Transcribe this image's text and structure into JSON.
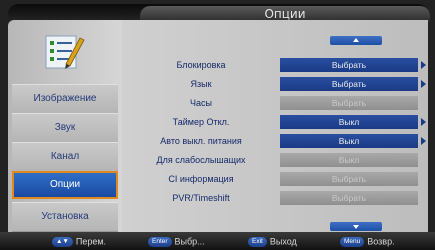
{
  "title": "Опции",
  "logo_icon": "checklist-pencil-icon",
  "menu": [
    {
      "label": "Изображение",
      "active": false
    },
    {
      "label": "Звук",
      "active": false
    },
    {
      "label": "Канал",
      "active": false
    },
    {
      "label": "Опции",
      "active": true
    },
    {
      "label": "Установка",
      "active": false
    }
  ],
  "options": [
    {
      "label": "Блокировка",
      "value": "Выбрать",
      "enabled": true,
      "arrow": true
    },
    {
      "label": "Язык",
      "value": "Выбрать",
      "enabled": true,
      "arrow": true
    },
    {
      "label": "Часы",
      "value": "Выбрать",
      "enabled": false,
      "arrow": false
    },
    {
      "label": "Таймер Откл.",
      "value": "Выкл",
      "enabled": true,
      "arrow": true
    },
    {
      "label": "Авто выкл. питания",
      "value": "Выкл",
      "enabled": true,
      "arrow": true
    },
    {
      "label": "Для слабослышащих",
      "value": "Выкл",
      "enabled": false,
      "arrow": false
    },
    {
      "label": "CI информация",
      "value": "Выбрать",
      "enabled": false,
      "arrow": false
    },
    {
      "label": "PVR/Timeshift",
      "value": "Выбрать",
      "enabled": false,
      "arrow": false
    }
  ],
  "hints": [
    {
      "key": "▲▼",
      "text": "Перем."
    },
    {
      "key": "Enter",
      "text": "Выбр..."
    },
    {
      "key": "Exit",
      "text": "Выход"
    },
    {
      "key": "Menu",
      "text": "Возвр."
    }
  ],
  "colors": {
    "accent": "#1a3a86",
    "active_border": "#e08a1e"
  }
}
